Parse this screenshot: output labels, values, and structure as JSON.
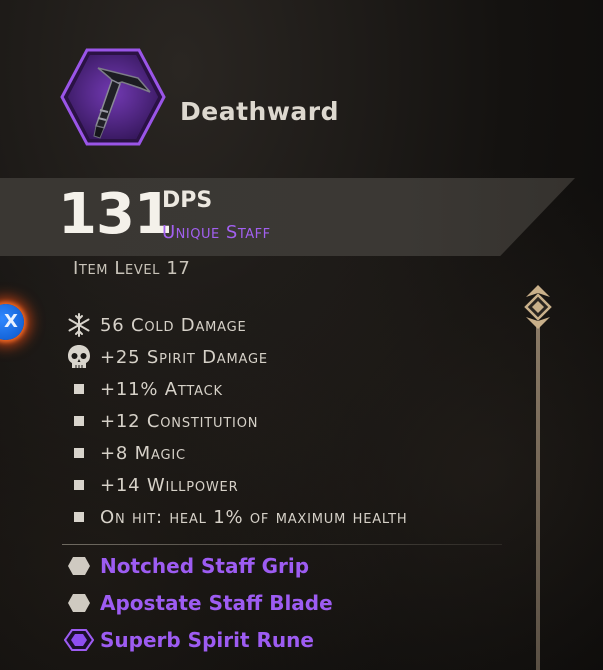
{
  "item": {
    "name": "Deathward",
    "dps_value": "131",
    "dps_label": "DPS",
    "type": "Unique Staff",
    "item_level": "Item Level 17"
  },
  "controls": {
    "x_button_label": "X"
  },
  "stats": [
    {
      "icon": "snowflake-icon",
      "text": "56 Cold Damage"
    },
    {
      "icon": "skull-icon",
      "text": "+25 Spirit Damage"
    },
    {
      "icon": "bullet",
      "text": "+11% Attack"
    },
    {
      "icon": "bullet",
      "text": "+12 Constitution"
    },
    {
      "icon": "bullet",
      "text": "+8 Magic"
    },
    {
      "icon": "bullet",
      "text": "+14 Willpower"
    },
    {
      "icon": "bullet",
      "text": "On hit: heal 1% of maximum health"
    }
  ],
  "upgrade_slots": [
    {
      "icon": "empty-hex-slot-icon",
      "text": "Notched Staff Grip"
    },
    {
      "icon": "empty-hex-slot-icon",
      "text": "Apostate Staff Blade"
    },
    {
      "icon": "purple-rune-slot-icon",
      "text": "Superb Spirit Rune"
    }
  ],
  "colors": {
    "rarity_purple": "#a260f0",
    "hex_border": "#8b47d8",
    "hex_fill": "#4a1f7a",
    "x_button_blue": "#1f74f0",
    "x_button_glow": "#ff5014"
  }
}
